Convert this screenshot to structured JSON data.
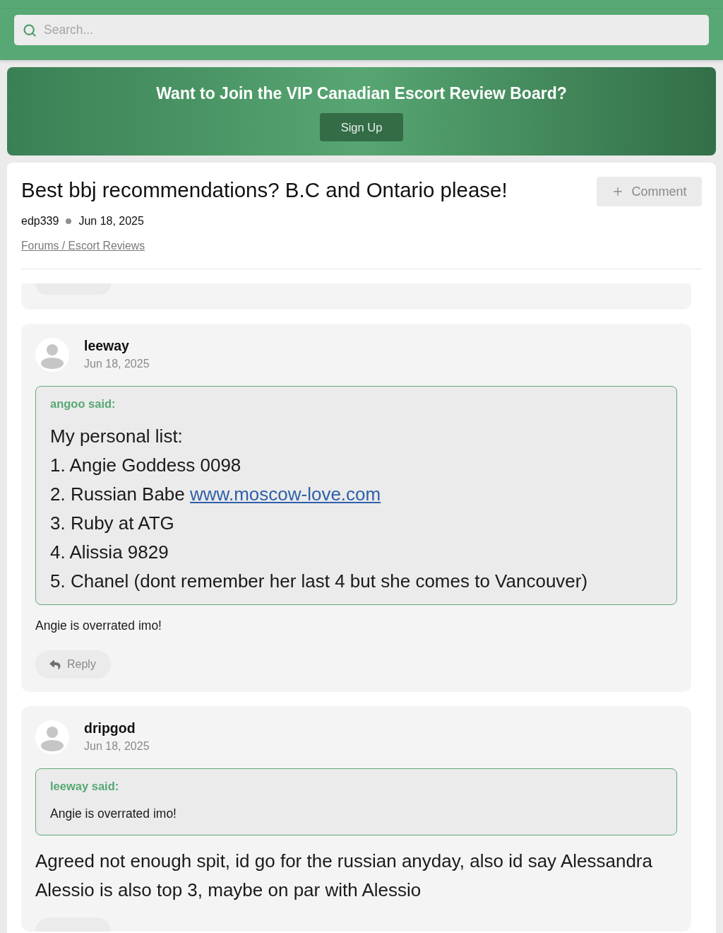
{
  "search": {
    "placeholder": "Search..."
  },
  "banner": {
    "title": "Want to Join the VIP Canadian Escort Review Board?",
    "button": "Sign Up"
  },
  "thread": {
    "title": "Best bbj recommendations? B.C and Ontario please!",
    "comment_button": "Comment",
    "author": "edp339",
    "date": "Jun 18, 2025",
    "breadcrumb": "Forums / Escort Reviews"
  },
  "comments": [
    {
      "kind": "tail",
      "reply": {
        "kind": "lower_part"
      }
    },
    {
      "kind": "post",
      "author": "leeway",
      "date": "Jun 18, 2025",
      "quote": {
        "author_line": "angoo said:",
        "kind": "rich_text",
        "lines": [
          {
            "text": "My personal list:"
          },
          {
            "text": "1. Angie Goddess 0098"
          },
          {
            "text": "2. Russian Babe",
            "link": "www.moscow-love.com"
          },
          {
            "text": "3. Ruby at ATG"
          },
          {
            "text": "4. Alissia 9829"
          },
          {
            "text": "5. Chanel (dont remember her last 4 but she comes to Vancouver)"
          }
        ]
      },
      "body": {
        "kind": "plain_text",
        "lines": [
          {
            "text": "Angie is overrated imo!"
          }
        ]
      },
      "reply": {
        "kind": "full",
        "label": "Reply"
      }
    },
    {
      "kind": "post",
      "author": "dripgod",
      "date": "Jun 18, 2025",
      "quote": {
        "author_line": "leeway said:",
        "kind": "plain_text",
        "lines": [
          {
            "text": "Angie is overrated imo!"
          }
        ]
      },
      "body": {
        "kind": "rich_text",
        "lines": [
          {
            "text": "Agreed not enough spit, id go for the russian anyday, also id say Alessandra Alessio is also top 3, maybe on par with Alessio"
          }
        ]
      },
      "reply": {
        "kind": "upper_part"
      }
    }
  ]
}
